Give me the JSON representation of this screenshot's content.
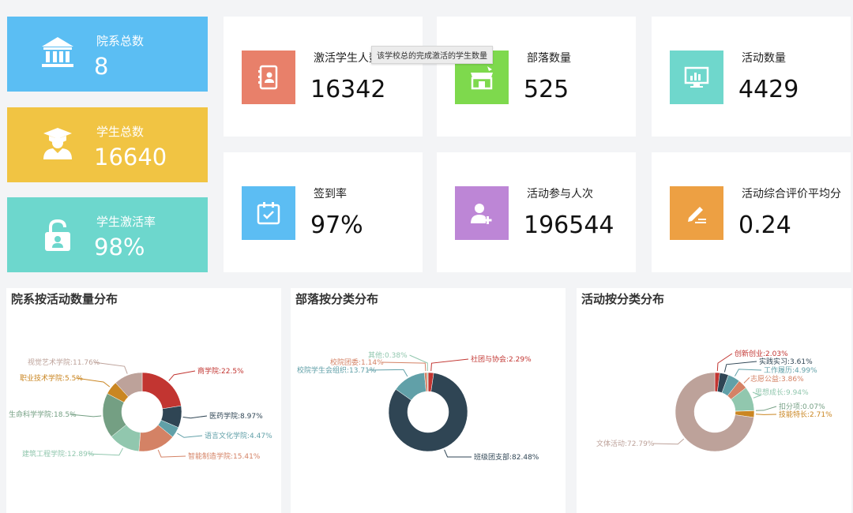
{
  "summary": {
    "departments": {
      "label": "院系总数",
      "value": "8",
      "color": "#5bbef3"
    },
    "students": {
      "label": "学生总数",
      "value": "16640",
      "color": "#f1c443"
    },
    "activation": {
      "label": "学生激活率",
      "value": "98%",
      "color": "#6dd7cd"
    }
  },
  "stats": [
    {
      "label": "激活学生人数",
      "value": "16342",
      "color": "#e8806a",
      "icon": "contact-book-icon"
    },
    {
      "label": "部落数量",
      "value": "525",
      "color": "#7ed94d",
      "icon": "store-icon"
    },
    {
      "label": "活动数量",
      "value": "4429",
      "color": "#6fd7cc",
      "icon": "monitor-chart-icon"
    },
    {
      "label": "签到率",
      "value": "97%",
      "color": "#5cbdf3",
      "icon": "calendar-check-icon"
    },
    {
      "label": "活动参与人次",
      "value": "196544",
      "color": "#bd86d6",
      "icon": "add-user-icon"
    },
    {
      "label": "活动综合评价平均分",
      "value": "0.24",
      "color": "#eda043",
      "icon": "pencil-icon"
    }
  ],
  "tooltip": "该学校总的完成激活的学生数量",
  "chart_data": [
    {
      "type": "pie",
      "title": "院系按活动数量分布",
      "slices": [
        {
          "name": "商学院",
          "value": 22.5,
          "label": "商学院:22.5%",
          "color": "#c23531"
        },
        {
          "name": "医药学院",
          "value": 8.97,
          "label": "医药学院:8.97%",
          "color": "#2f4554"
        },
        {
          "name": "语言文化学院",
          "value": 4.47,
          "label": "语言文化学院:4.47%",
          "color": "#61a0a8"
        },
        {
          "name": "智能制造学院",
          "value": 15.41,
          "label": "智能制造学院:15.41%",
          "color": "#d48265"
        },
        {
          "name": "建筑工程学院",
          "value": 12.89,
          "label": "建筑工程学院:12.89%",
          "color": "#91c7ae"
        },
        {
          "name": "生命科学学院",
          "value": 18.5,
          "label": "生命科学学院:18.5%",
          "color": "#749f83"
        },
        {
          "name": "职业技术学院",
          "value": 5.5,
          "label": "职业技术学院:5.5%",
          "color": "#ca8622"
        },
        {
          "name": "视觉艺术学院",
          "value": 11.76,
          "label": "视觉艺术学院:11.76%",
          "color": "#bda29a"
        }
      ]
    },
    {
      "type": "pie",
      "title": "部落按分类分布",
      "slices": [
        {
          "name": "社团与协会",
          "value": 2.29,
          "label": "社团与协会:2.29%",
          "color": "#c23531"
        },
        {
          "name": "班级团支部",
          "value": 82.48,
          "label": "班级团支部:82.48%",
          "color": "#2f4554"
        },
        {
          "name": "校院学生会组织",
          "value": 13.71,
          "label": "校院学生会组织:13.71%",
          "color": "#61a0a8"
        },
        {
          "name": "校院团委",
          "value": 1.14,
          "label": "校院团委:1.14%",
          "color": "#d48265"
        },
        {
          "name": "其他",
          "value": 0.38,
          "label": "其他:0.38%",
          "color": "#91c7ae"
        }
      ]
    },
    {
      "type": "pie",
      "title": "活动按分类分布",
      "slices": [
        {
          "name": "创新创业",
          "value": 2.03,
          "label": "创新创业:2.03%",
          "color": "#c23531"
        },
        {
          "name": "实践实习",
          "value": 3.61,
          "label": "实践实习:3.61%",
          "color": "#2f4554"
        },
        {
          "name": "工作履历",
          "value": 4.99,
          "label": "工作履历:4.99%",
          "color": "#61a0a8"
        },
        {
          "name": "志愿公益",
          "value": 3.86,
          "label": "志愿公益:3.86%",
          "color": "#d48265"
        },
        {
          "name": "思想成长",
          "value": 9.94,
          "label": "思想成长:9.94%",
          "color": "#91c7ae"
        },
        {
          "name": "扣分项",
          "value": 0.07,
          "label": "扣分项:0.07%",
          "color": "#749f83"
        },
        {
          "name": "技能特长",
          "value": 2.71,
          "label": "技能特长:2.71%",
          "color": "#ca8622"
        },
        {
          "name": "文体活动",
          "value": 72.79,
          "label": "文体活动:72.79%",
          "color": "#bda29a"
        }
      ]
    }
  ]
}
